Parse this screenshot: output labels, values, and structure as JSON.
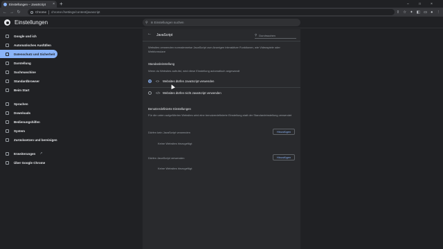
{
  "browser": {
    "tab_title": "Einstellungen – JavaScript",
    "tab_close": "×",
    "new_tab": "+",
    "window_controls": [
      "–",
      "□",
      "×"
    ],
    "nav": [
      "←",
      "→",
      "↻"
    ],
    "site_label": "Chrome",
    "url": "chrome://settings/content/javascript",
    "toolbar_icons": [
      "⇪",
      "☆",
      "✦",
      "◧",
      "▭",
      "●",
      "⋮"
    ]
  },
  "header": {
    "app_title": "Einstellungen",
    "search_placeholder": "In Einstellungen suchen"
  },
  "sidebar": {
    "items": [
      {
        "label": "Google und ich"
      },
      {
        "label": "Automatisches Ausfüllen"
      },
      {
        "label": "Datenschutz und Sicherheit"
      },
      {
        "label": "Darstellung"
      },
      {
        "label": "Suchmaschine"
      },
      {
        "label": "Standardbrowser"
      },
      {
        "label": "Beim Start"
      },
      {
        "label": "Sprachen"
      },
      {
        "label": "Downloads"
      },
      {
        "label": "Bedienungshilfen"
      },
      {
        "label": "System"
      },
      {
        "label": "Zurücksetzen und bereinigen"
      },
      {
        "label": "Erweiterungen"
      },
      {
        "label": "Über Google Chrome"
      }
    ],
    "ext_link_icon": "↗"
  },
  "panel": {
    "back_icon": "←",
    "title": "JavaScript",
    "search_placeholder": "Durchsuchen",
    "description": "Websites verwenden normalerweise JavaScript zum Anzeigen interaktiver Funktionen, wie Videospiele oder Webformulare",
    "default_heading": "Standardeinstellung",
    "default_sub": "Wenn du Websites aufrufst, wird diese Einstellung automatisch angewandt",
    "options": [
      {
        "icon": "<>",
        "label": "Websites dürfen JavaScript verwenden",
        "selected": true
      },
      {
        "icon": "</>",
        "label": "Websites dürfen nicht JavaScript verwenden",
        "selected": false
      }
    ],
    "custom_heading": "Benutzerdefinierte Einstellungen",
    "custom_sub": "Für die unten aufgeführten Websites wird eine benutzerdefinierte Einstellung statt der Standardeinstellung verwendet",
    "not_allowed_label": "Dürfen kein JavaScript verwenden",
    "allowed_label": "Dürfen JavaScript verwenden",
    "add_button": "Hinzufügen",
    "empty_text": "Keine Websites hinzugefügt"
  },
  "colors": {
    "accent": "#8ab4f8",
    "background": "#202124",
    "panel": "#292a2d"
  }
}
